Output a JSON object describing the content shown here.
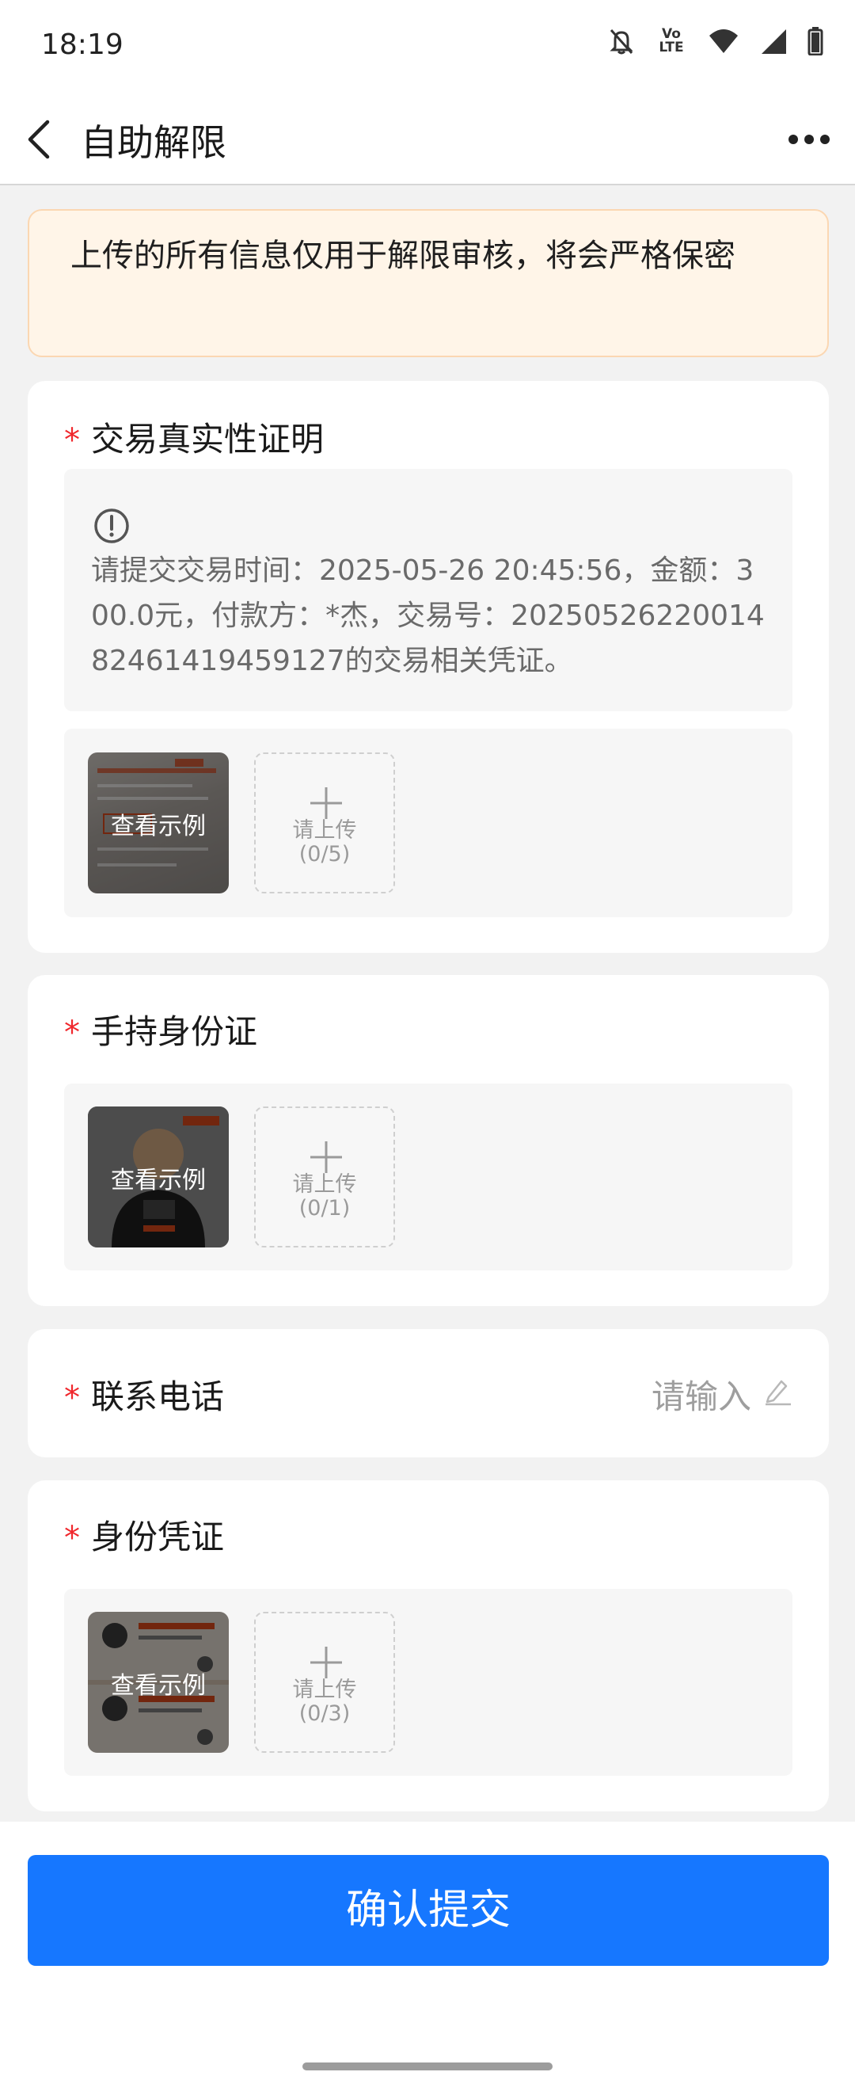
{
  "status_bar": {
    "time": "18:19",
    "volte_top": "Vo",
    "volte_bottom": "LTE",
    "icons": [
      "bell-off-icon",
      "volte-icon",
      "wifi-icon",
      "signal-icon",
      "battery-icon"
    ]
  },
  "nav": {
    "title": "自助解限",
    "back_icon": "chevron-left-icon",
    "more_icon": "more-horizontal-icon"
  },
  "notice": {
    "text": "上传的所有信息仅用于解限审核，将会严格保密"
  },
  "sections": {
    "transaction": {
      "required_mark": "*",
      "title": "交易真实性证明",
      "hint": "请提交交易时间：2025-05-26 20:45:56，金额：300.0元，付款方：*杰，交易号：2025052622001482461419459127的交易相关凭证。",
      "example_label": "查看示例",
      "upload_label": "请上传",
      "upload_count": "(0/5)"
    },
    "id_handheld": {
      "required_mark": "*",
      "title": "手持身份证",
      "example_label": "查看示例",
      "upload_label": "请上传",
      "upload_count": "(0/1)"
    },
    "phone": {
      "required_mark": "*",
      "title": "联系电话",
      "placeholder": "请输入"
    },
    "id_proof": {
      "required_mark": "*",
      "title": "身份凭证",
      "example_label": "查看示例",
      "upload_label": "请上传",
      "upload_count": "(0/3)"
    }
  },
  "submit_label": "确认提交",
  "colors": {
    "accent": "#1677ff",
    "required": "#f0282d",
    "notice_bg": "#fff5e8",
    "notice_border": "#fbd7b2"
  }
}
